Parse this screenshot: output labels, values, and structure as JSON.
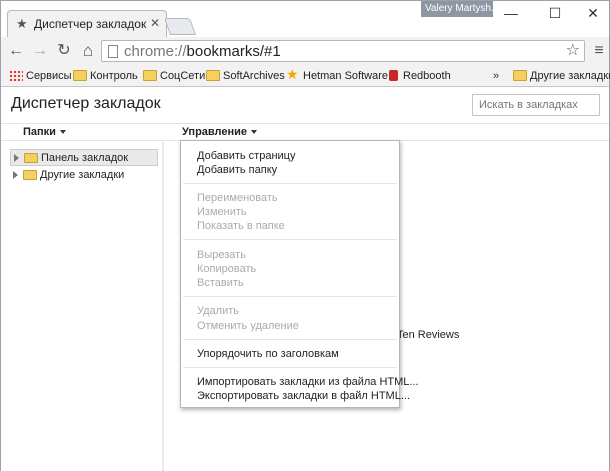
{
  "window": {
    "tab_title": "Диспетчер закладок",
    "tab_close_glyph": "✕",
    "user_name": "Valery Martysh...",
    "controls": {
      "minimize": "—",
      "maximize": "☐",
      "close": "✕"
    }
  },
  "toolbar": {
    "back_glyph": "←",
    "forward_glyph": "→",
    "reload_glyph": "↻",
    "home_glyph": "⌂",
    "url_scheme": "chrome://",
    "url_rest": "bookmarks/#1",
    "bookmark_star_glyph": "☆",
    "menu_glyph": "≡"
  },
  "bookmarks_bar": {
    "items": [
      {
        "label": "Сервисы",
        "icon": "apps-icon"
      },
      {
        "label": "Контроль",
        "icon": "folder-icon"
      },
      {
        "label": "СоцСети",
        "icon": "folder-icon"
      },
      {
        "label": "SoftArchives",
        "icon": "folder-icon"
      },
      {
        "label": "Hetman Software",
        "icon": "star-icon"
      },
      {
        "label": "Redbooth",
        "icon": "redbooth-icon"
      }
    ],
    "overflow_glyph": "»",
    "other_label": "Другие закладки"
  },
  "page": {
    "title": "Диспетчер закладок",
    "search_placeholder": "Искать в закладках",
    "folders_label": "Папки",
    "organize_label": "Управление",
    "tree": [
      {
        "label": "Панель закладок",
        "selected": true
      },
      {
        "label": "Другие закладки",
        "selected": false
      }
    ],
    "background_text": "Ten Reviews"
  },
  "menu": {
    "groups": [
      [
        {
          "label": "Добавить страницу",
          "enabled": true
        },
        {
          "label": "Добавить папку",
          "enabled": true
        }
      ],
      [
        {
          "label": "Переименовать",
          "enabled": false
        },
        {
          "label": "Изменить",
          "enabled": false
        },
        {
          "label": "Показать в папке",
          "enabled": false
        }
      ],
      [
        {
          "label": "Вырезать",
          "enabled": false
        },
        {
          "label": "Копировать",
          "enabled": false
        },
        {
          "label": "Вставить",
          "enabled": false
        }
      ],
      [
        {
          "label": "Удалить",
          "enabled": false
        },
        {
          "label": "Отменить удаление",
          "enabled": false
        }
      ],
      [
        {
          "label": "Упорядочить по заголовкам",
          "enabled": true
        }
      ],
      [
        {
          "label": "Импортировать закладки из файла HTML...",
          "enabled": true
        },
        {
          "label": "Экспортировать закладки в файл HTML...",
          "enabled": true
        }
      ]
    ]
  },
  "colors": {
    "folder": "#f5d05f",
    "star": "#f2a900",
    "redbooth": "#c62828"
  }
}
